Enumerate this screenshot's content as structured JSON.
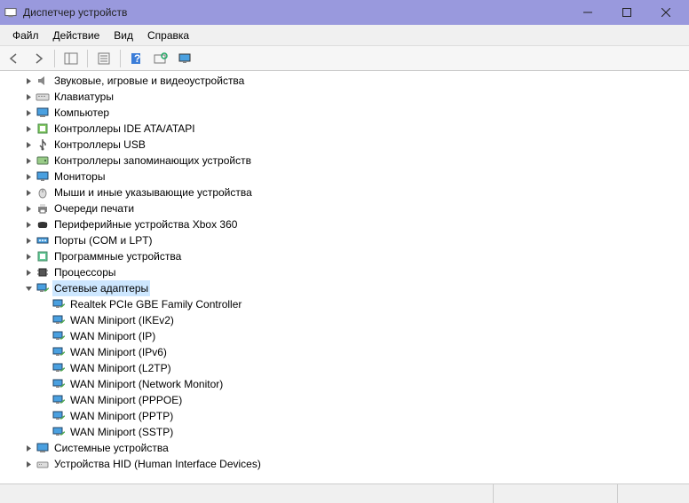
{
  "window": {
    "title": "Диспетчер устройств"
  },
  "menu": {
    "file": "Файл",
    "action": "Действие",
    "view": "Вид",
    "help": "Справка"
  },
  "tree": {
    "items": [
      {
        "label": "Звуковые, игровые и видеоустройства",
        "icon": "audio",
        "indent": 1,
        "expand": "closed"
      },
      {
        "label": "Клавиатуры",
        "icon": "keyboard",
        "indent": 1,
        "expand": "closed"
      },
      {
        "label": "Компьютер",
        "icon": "computer",
        "indent": 1,
        "expand": "closed"
      },
      {
        "label": "Контроллеры IDE ATA/ATAPI",
        "icon": "ide",
        "indent": 1,
        "expand": "closed"
      },
      {
        "label": "Контроллеры USB",
        "icon": "usb",
        "indent": 1,
        "expand": "closed"
      },
      {
        "label": "Контроллеры запоминающих устройств",
        "icon": "storage",
        "indent": 1,
        "expand": "closed"
      },
      {
        "label": "Мониторы",
        "icon": "monitor",
        "indent": 1,
        "expand": "closed"
      },
      {
        "label": "Мыши и иные указывающие устройства",
        "icon": "mouse",
        "indent": 1,
        "expand": "closed"
      },
      {
        "label": "Очереди печати",
        "icon": "printer",
        "indent": 1,
        "expand": "closed"
      },
      {
        "label": "Периферийные устройства Xbox 360",
        "icon": "xbox",
        "indent": 1,
        "expand": "closed"
      },
      {
        "label": "Порты (COM и LPT)",
        "icon": "port",
        "indent": 1,
        "expand": "closed"
      },
      {
        "label": "Программные устройства",
        "icon": "software",
        "indent": 1,
        "expand": "closed"
      },
      {
        "label": "Процессоры",
        "icon": "cpu",
        "indent": 1,
        "expand": "closed"
      },
      {
        "label": "Сетевые адаптеры",
        "icon": "network",
        "indent": 1,
        "expand": "open",
        "selected": true
      },
      {
        "label": "Realtek PCIe GBE Family Controller",
        "icon": "network",
        "indent": 2,
        "expand": "none"
      },
      {
        "label": "WAN Miniport (IKEv2)",
        "icon": "network",
        "indent": 2,
        "expand": "none"
      },
      {
        "label": "WAN Miniport (IP)",
        "icon": "network",
        "indent": 2,
        "expand": "none"
      },
      {
        "label": "WAN Miniport (IPv6)",
        "icon": "network",
        "indent": 2,
        "expand": "none"
      },
      {
        "label": "WAN Miniport (L2TP)",
        "icon": "network",
        "indent": 2,
        "expand": "none"
      },
      {
        "label": "WAN Miniport (Network Monitor)",
        "icon": "network",
        "indent": 2,
        "expand": "none"
      },
      {
        "label": "WAN Miniport (PPPOE)",
        "icon": "network",
        "indent": 2,
        "expand": "none"
      },
      {
        "label": "WAN Miniport (PPTP)",
        "icon": "network",
        "indent": 2,
        "expand": "none"
      },
      {
        "label": "WAN Miniport (SSTP)",
        "icon": "network",
        "indent": 2,
        "expand": "none"
      },
      {
        "label": "Системные устройства",
        "icon": "system",
        "indent": 1,
        "expand": "closed"
      },
      {
        "label": "Устройства HID (Human Interface Devices)",
        "icon": "hid",
        "indent": 1,
        "expand": "closed"
      }
    ]
  }
}
